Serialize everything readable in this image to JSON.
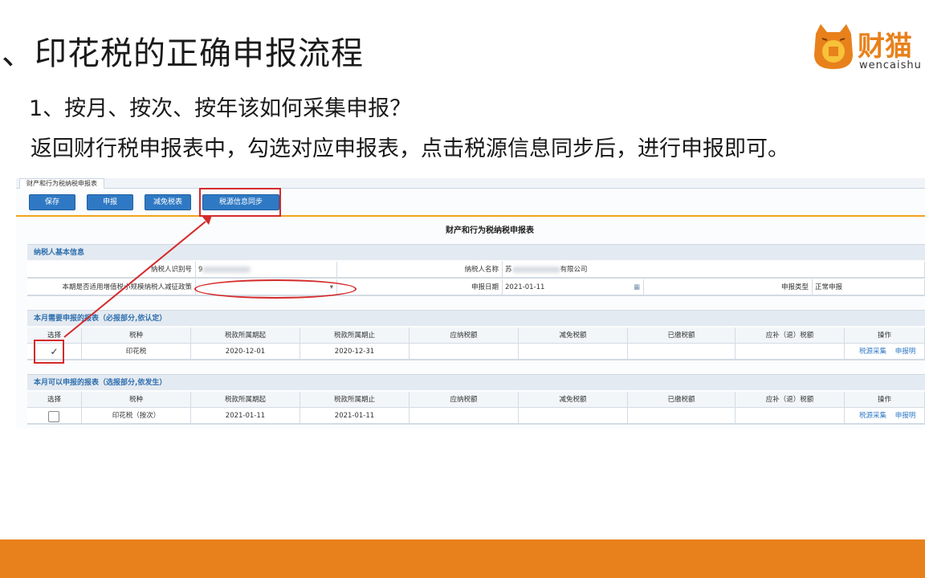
{
  "slide": {
    "title": "、印花税的正确申报流程",
    "question": "1、按月、按次、按年该如何采集申报？",
    "description": "返回财行税申报表中，勾选对应申报表，点击税源信息同步后，进行申报即可。"
  },
  "logo": {
    "brand": "财猫",
    "subtitle": "wencaishu"
  },
  "screenshot": {
    "tab_label": "财产和行为税纳税申报表",
    "toolbar": {
      "save": "保存",
      "declare": "申报",
      "exempt": "减免税表",
      "sync": "税源信息同步"
    },
    "form_title": "财产和行为税纳税申报表",
    "basic_info": {
      "header": "纳税人基本信息",
      "taxpayer_id_label": "纳税人识别号",
      "taxpayer_id_value": "9",
      "taxpayer_name_label": "纳税人名称",
      "taxpayer_name_value_prefix": "苏",
      "taxpayer_name_value_suffix": "有限公司",
      "policy_label": "本期是否适用增值税小规模纳税人减征政策",
      "declare_date_label": "申报日期",
      "declare_date_value": "2021-01-11",
      "declare_type_label": "申报类型",
      "declare_type_value": "正常申报"
    },
    "required_section": {
      "header": "本月需要申报的报表（必报部分,依认定）",
      "columns": [
        "选择",
        "税种",
        "税款所属期起",
        "税款所属期止",
        "应纳税额",
        "减免税额",
        "已缴税额",
        "应补（退）税额",
        "操作"
      ],
      "row": {
        "tax": "印花税",
        "start": "2020-12-01",
        "end": "2020-12-31",
        "check_mark": "✓",
        "action_collect": "税源采集",
        "action_detail": "申报明"
      }
    },
    "optional_section": {
      "header": "本月可以申报的报表（选报部分,依发生）",
      "columns": [
        "选择",
        "税种",
        "税款所属期起",
        "税款所属期止",
        "应纳税额",
        "减免税额",
        "已缴税额",
        "应补（退）税额",
        "操作"
      ],
      "row": {
        "tax": "印花税（按次）",
        "start": "2021-01-11",
        "end": "2021-01-11",
        "action_collect": "税源采集",
        "action_detail": "申报明"
      }
    }
  },
  "colors": {
    "accent": "#e8811b",
    "button": "#2f79c4",
    "annotation": "#d42a2a"
  }
}
